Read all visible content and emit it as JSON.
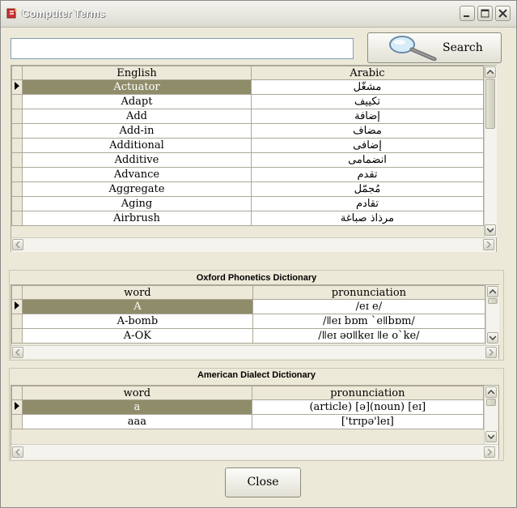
{
  "window": {
    "title": "Computer Terms"
  },
  "search": {
    "value": "",
    "button_label": "Search"
  },
  "terms_grid": {
    "columns": [
      "English",
      "Arabic"
    ],
    "rows": [
      {
        "english": "Actuator",
        "arabic": "مشغّل"
      },
      {
        "english": "Adapt",
        "arabic": "تكييف"
      },
      {
        "english": "Add",
        "arabic": "إضافة"
      },
      {
        "english": "Add-in",
        "arabic": "مضاف"
      },
      {
        "english": "Additional",
        "arabic": "إضافى"
      },
      {
        "english": "Additive",
        "arabic": "انضمامى"
      },
      {
        "english": "Advance",
        "arabic": "تقدم"
      },
      {
        "english": "Aggregate",
        "arabic": "مُجمّل"
      },
      {
        "english": "Aging",
        "arabic": "تقادم"
      },
      {
        "english": "Airbrush",
        "arabic": "مرذاذ صباغة"
      }
    ],
    "selected_index": 0
  },
  "oxford": {
    "title": "Oxford Phonetics Dictionary",
    "columns": [
      "word",
      "pronunciation"
    ],
    "rows": [
      {
        "word": "A",
        "pron": "/eɪ e/"
      },
      {
        "word": "A-bomb",
        "pron": "/ǁeɪ bɒm `eǁbɒm/"
      },
      {
        "word": "A-OK",
        "pron": "/ǁeɪ əʊǁkeɪ ǁe o`ke/"
      }
    ],
    "selected_index": 0
  },
  "american": {
    "title": "American Dialect Dictionary",
    "columns": [
      "word",
      "pronunciation"
    ],
    "rows": [
      {
        "word": "a",
        "pron": "(article) [ə](noun) [eɪ]"
      },
      {
        "word": "aaa",
        "pron": "['trɪpə'leɪ]"
      }
    ],
    "selected_index": 0
  },
  "footer": {
    "close_label": "Close"
  },
  "colors": {
    "selected_row": "#8f8c6a",
    "window_bg": "#ece9d8",
    "grid_border": "#aca899"
  }
}
